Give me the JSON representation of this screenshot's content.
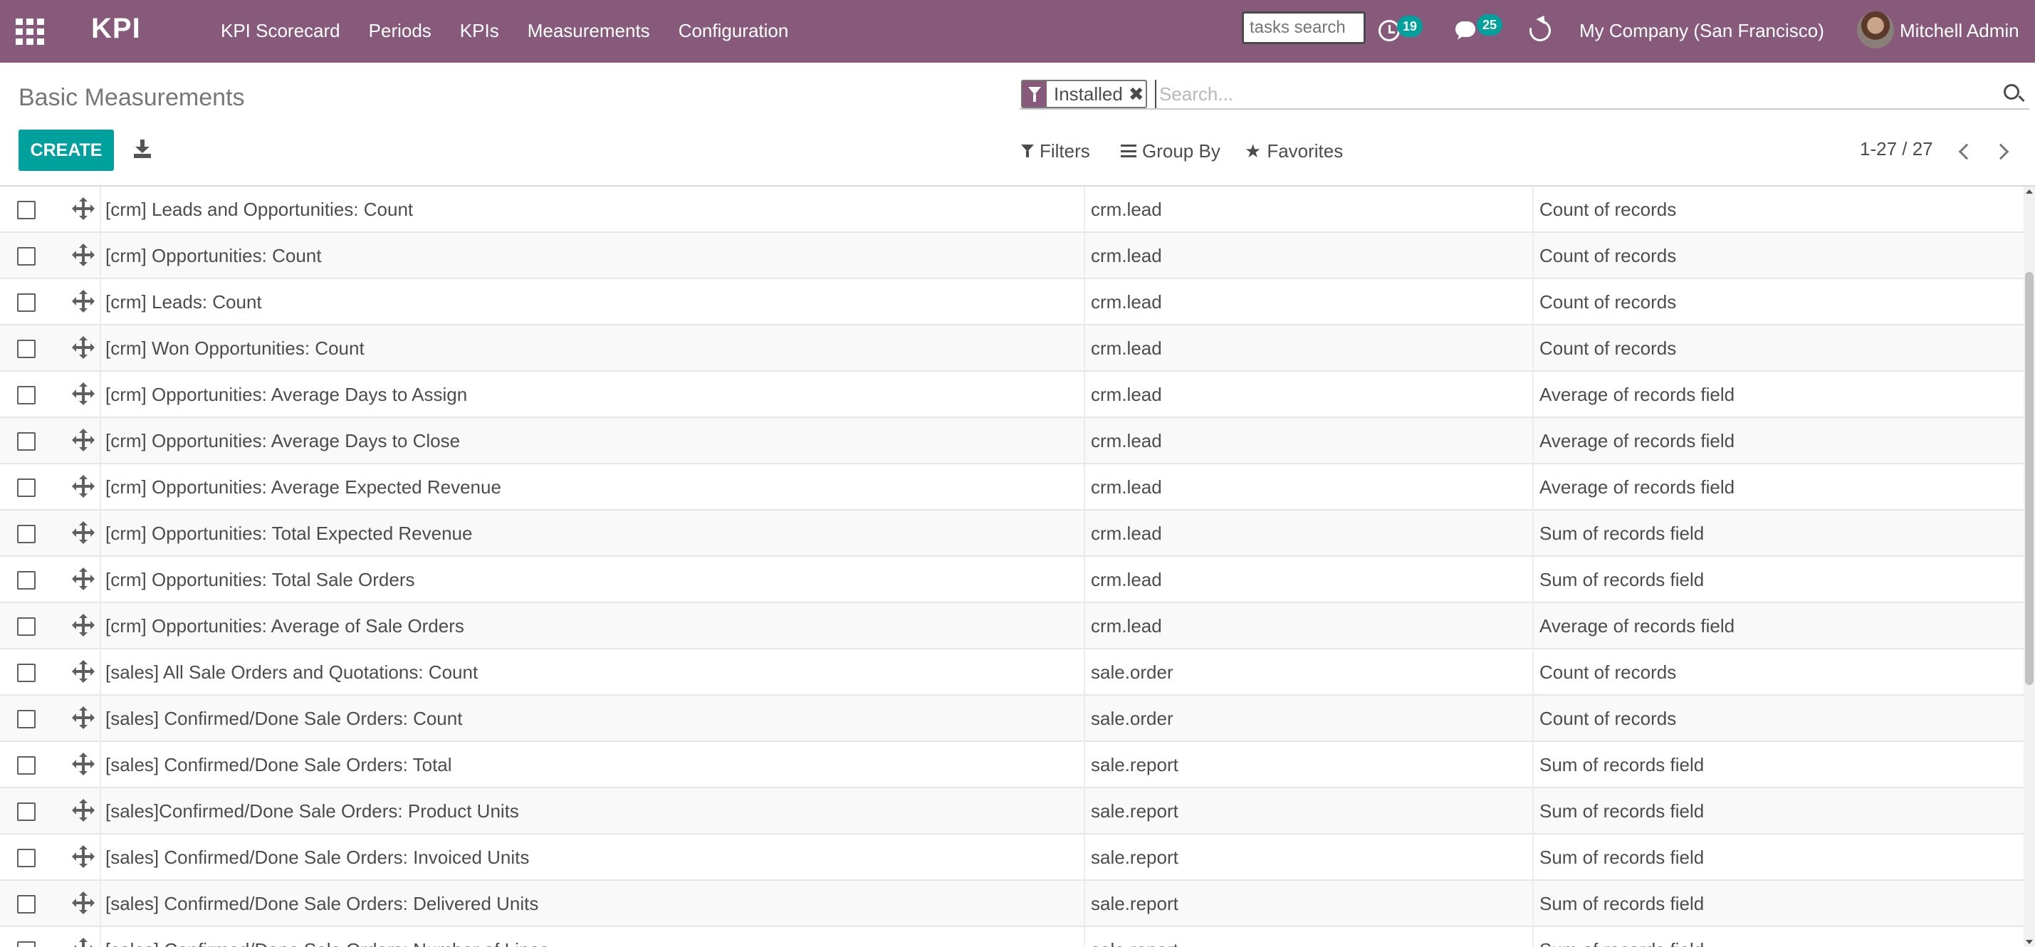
{
  "navbar": {
    "brand": "KPI",
    "menu": [
      "KPI Scorecard",
      "Periods",
      "KPIs",
      "Measurements",
      "Configuration"
    ],
    "tasks_search_placeholder": "tasks search",
    "activity_count": "19",
    "messages_count": "25",
    "company": "My Company (San Francisco)",
    "user": "Mitchell Admin",
    "bg_color": "#875a7b"
  },
  "control_panel": {
    "title": "Basic Measurements",
    "facet_label": "Installed",
    "search_placeholder": "Search...",
    "create_label": "CREATE",
    "filters_label": "Filters",
    "groupby_label": "Group By",
    "favorites_label": "Favorites",
    "pager_value": "1-27 / 27",
    "accent_color": "#00a09d"
  },
  "rows": [
    {
      "name": "[crm] Leads and Opportunities: Count",
      "model": "crm.lead",
      "type": "Count of records"
    },
    {
      "name": "[crm] Opportunities: Count",
      "model": "crm.lead",
      "type": "Count of records"
    },
    {
      "name": "[crm] Leads: Count",
      "model": "crm.lead",
      "type": "Count of records"
    },
    {
      "name": "[crm] Won Opportunities: Count",
      "model": "crm.lead",
      "type": "Count of records"
    },
    {
      "name": "[crm] Opportunities: Average Days to Assign",
      "model": "crm.lead",
      "type": "Average of records field"
    },
    {
      "name": "[crm] Opportunities: Average Days to Close",
      "model": "crm.lead",
      "type": "Average of records field"
    },
    {
      "name": "[crm] Opportunities: Average Expected Revenue",
      "model": "crm.lead",
      "type": "Average of records field"
    },
    {
      "name": "[crm] Opportunities: Total Expected Revenue",
      "model": "crm.lead",
      "type": "Sum of records field"
    },
    {
      "name": "[crm] Opportunities: Total Sale Orders",
      "model": "crm.lead",
      "type": "Sum of records field"
    },
    {
      "name": "[crm] Opportunities: Average of Sale Orders",
      "model": "crm.lead",
      "type": "Average of records field"
    },
    {
      "name": "[sales] All Sale Orders and Quotations: Count",
      "model": "sale.order",
      "type": "Count of records"
    },
    {
      "name": "[sales] Confirmed/Done Sale Orders: Count",
      "model": "sale.order",
      "type": "Count of records"
    },
    {
      "name": "[sales] Confirmed/Done Sale Orders: Total",
      "model": "sale.report",
      "type": "Sum of records field"
    },
    {
      "name": "[sales]Confirmed/Done Sale Orders: Product Units",
      "model": "sale.report",
      "type": "Sum of records field"
    },
    {
      "name": "[sales] Confirmed/Done Sale Orders: Invoiced Units",
      "model": "sale.report",
      "type": "Sum of records field"
    },
    {
      "name": "[sales] Confirmed/Done Sale Orders: Delivered Units",
      "model": "sale.report",
      "type": "Sum of records field"
    },
    {
      "name": "[sales] Confirmed/Done Sale Orders: Number of Lines",
      "model": "sale.report",
      "type": "Sum of records field"
    }
  ]
}
